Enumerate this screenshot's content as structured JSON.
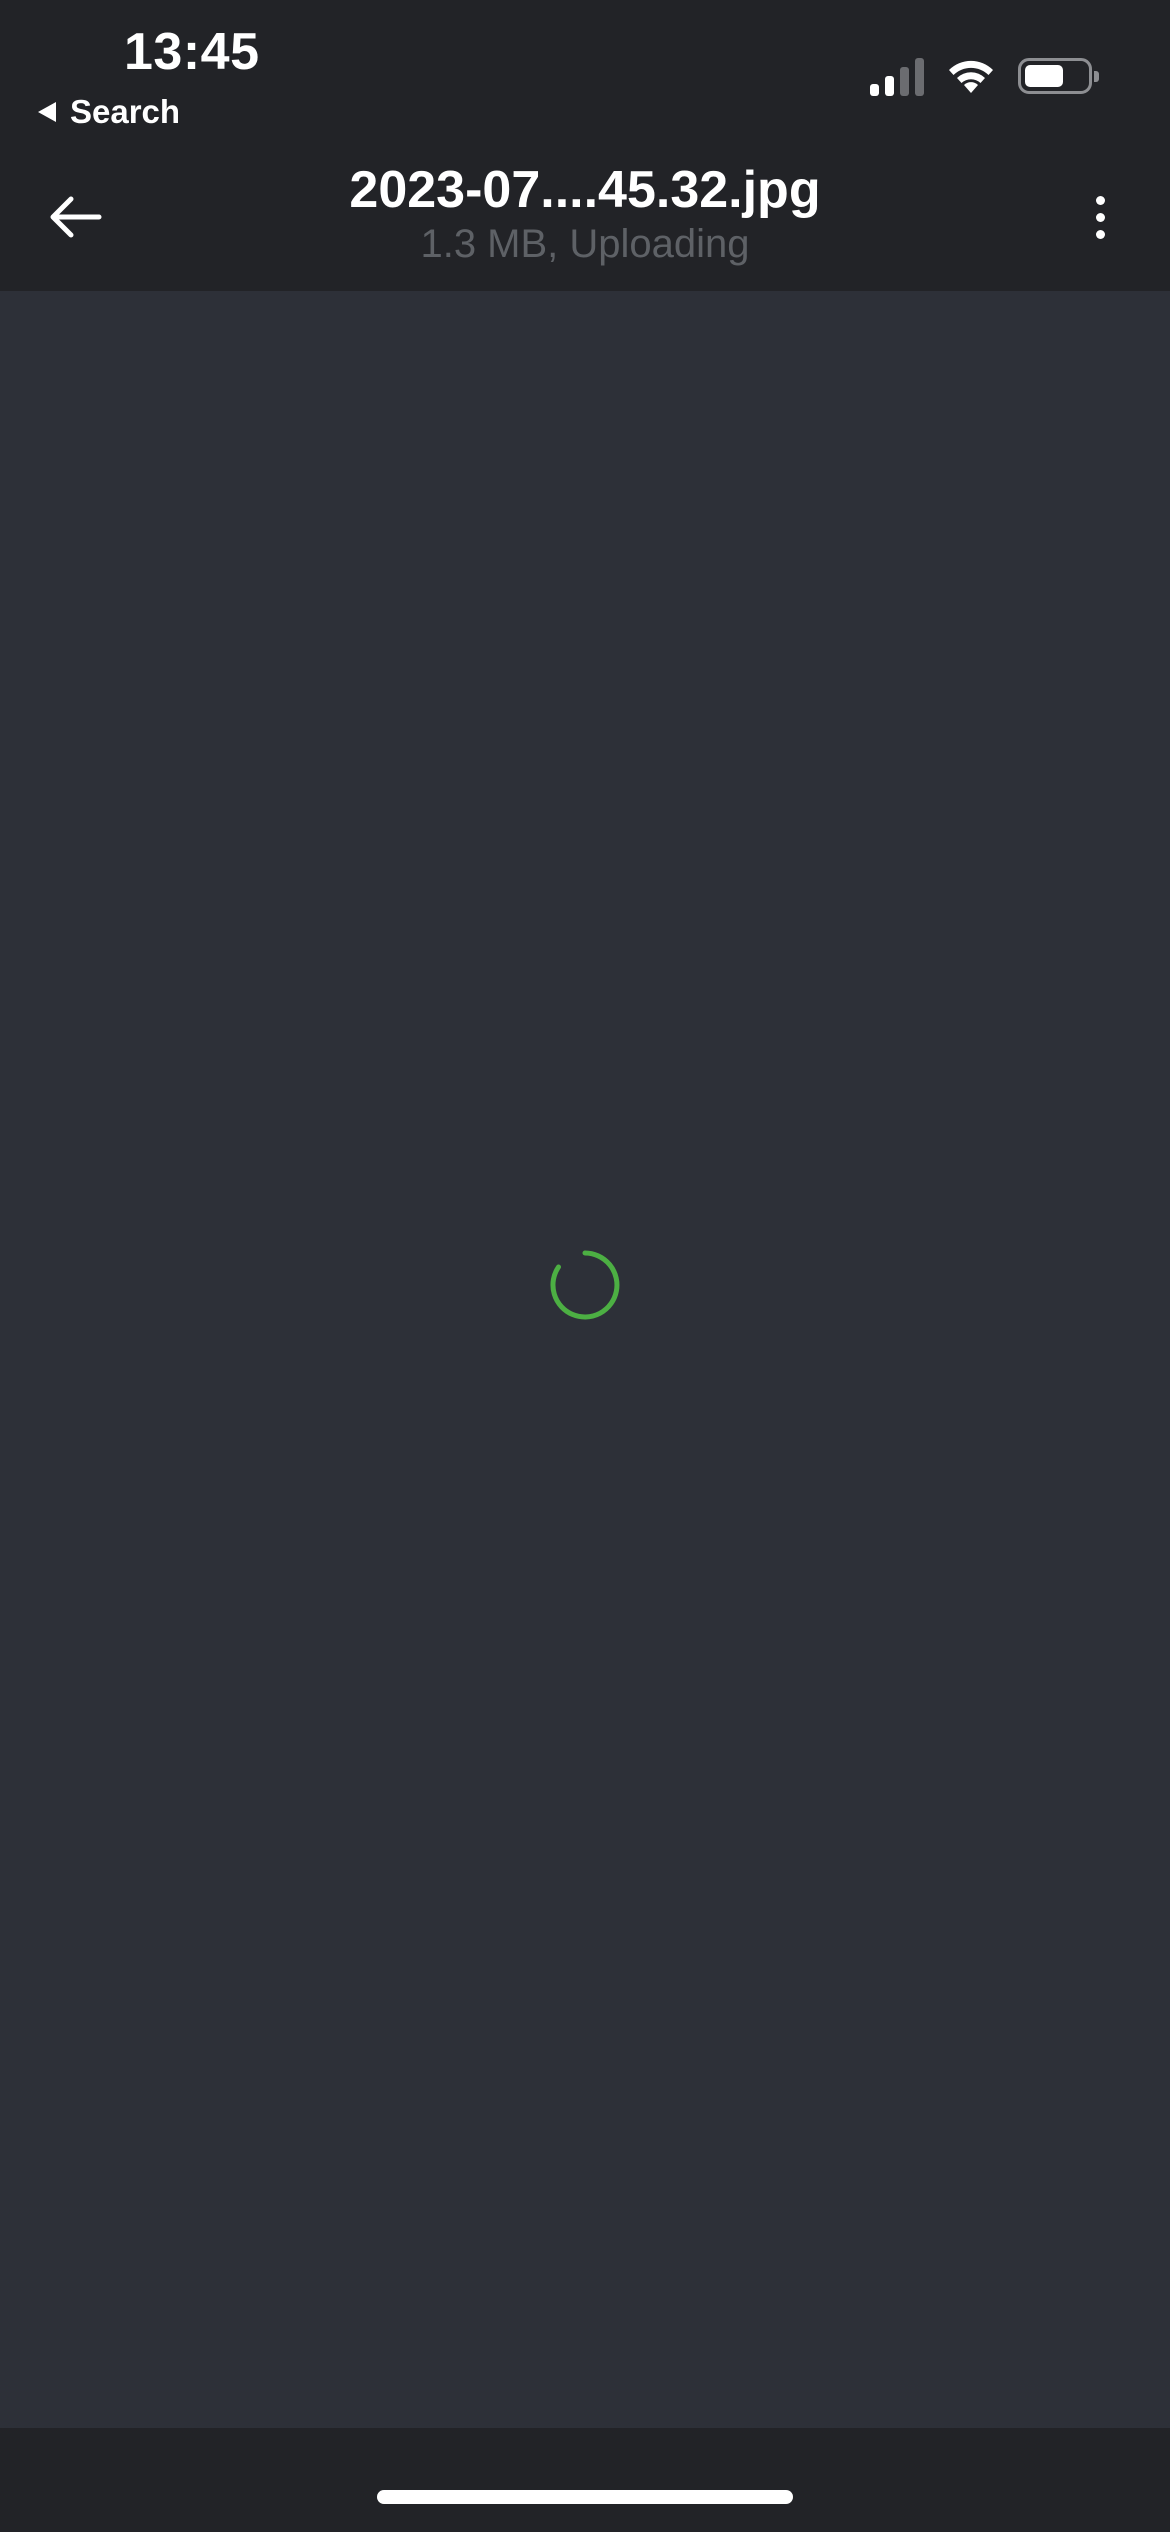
{
  "status_bar": {
    "time": "13:45",
    "back_app_label": "Search",
    "icons": [
      "signal-icon",
      "wifi-icon",
      "battery-icon"
    ],
    "battery_level": 0.55
  },
  "nav": {
    "title": "2023-07....45.32.jpg",
    "subtitle": "1.3 MB, Uploading",
    "back_icon": "arrow-left-icon",
    "more_icon": "more-vertical-icon"
  },
  "content": {
    "state_icon": "loading-spinner-icon"
  },
  "colors": {
    "header_bg": "#222327",
    "content_bg": "#2d3038",
    "subtitle": "#5e6166",
    "spinner": "#4caf43"
  }
}
